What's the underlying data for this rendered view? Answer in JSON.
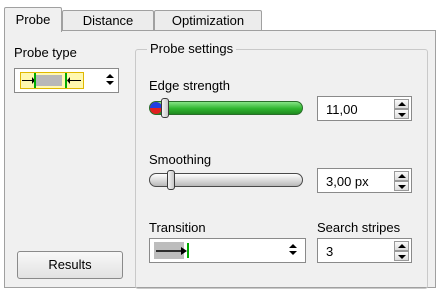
{
  "tabs": [
    {
      "label": "Probe",
      "active": true
    },
    {
      "label": "Distance",
      "active": false
    },
    {
      "label": "Optimization",
      "active": false
    }
  ],
  "probe_type": {
    "label": "Probe type",
    "icon": "probe-edge-pair-icon"
  },
  "probe_settings": {
    "title": "Probe settings",
    "edge_strength": {
      "label": "Edge strength",
      "value": "11,00",
      "slider_fraction": 0.02
    },
    "smoothing": {
      "label": "Smoothing",
      "value": "3,00 px",
      "slider_fraction": 0.05
    },
    "transition": {
      "label": "Transition",
      "icon": "dark-to-light-transition-icon"
    },
    "search_stripes": {
      "label": "Search stripes",
      "value": "3"
    }
  },
  "results_button": {
    "label": "Results"
  },
  "colors": {
    "accent_green": "#2fb52f",
    "edge_marker": "#e8c400"
  }
}
